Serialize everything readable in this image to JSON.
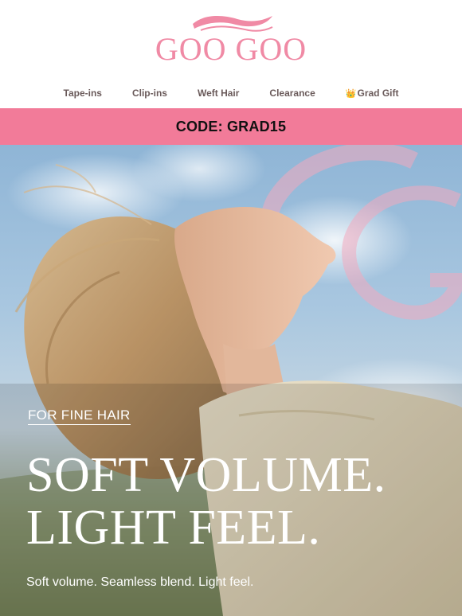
{
  "brand": {
    "logo_text": "GOO GOO",
    "color": "#f08aa5"
  },
  "nav": {
    "items": [
      {
        "label": "Tape-ins"
      },
      {
        "label": "Clip-ins"
      },
      {
        "label": "Weft Hair"
      },
      {
        "label": "Clearance"
      },
      {
        "label": "Grad Gift",
        "icon": "crown-icon",
        "icon_glyph": "👑"
      }
    ]
  },
  "promo": {
    "code_text": "CODE: GRAD15",
    "bg_color": "#f27b99"
  },
  "hero": {
    "eyebrow": "FOR FINE HAIR",
    "headline_line1": "SOFT VOLUME.",
    "headline_line2": "LIGHT FEEL.",
    "subline": "Soft volume. Seamless blend. Light feel."
  }
}
